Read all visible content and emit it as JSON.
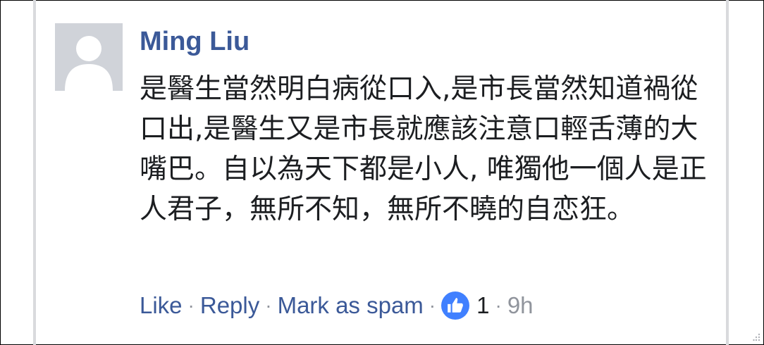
{
  "comment": {
    "author": "Ming Liu",
    "text": "是醫生當然明白病從口入,是市長當然知道禍從口出,是醫生又是市長就應該注意口輕舌薄的大嘴巴。自以為天下都是小人, 唯獨他一個人是正人君子，無所不知，無所不曉的自恋狂。",
    "actions": {
      "like": "Like",
      "reply": "Reply",
      "spam": "Mark as spam",
      "separator": "·",
      "reaction_count": "1",
      "time": "9h"
    }
  },
  "colors": {
    "link": "#3b5998",
    "like_badge": "#4080ff",
    "meta_gray": "#90949c"
  },
  "icons": {
    "avatar": "default-user-silhouette",
    "reaction": "thumbs-up-icon"
  }
}
